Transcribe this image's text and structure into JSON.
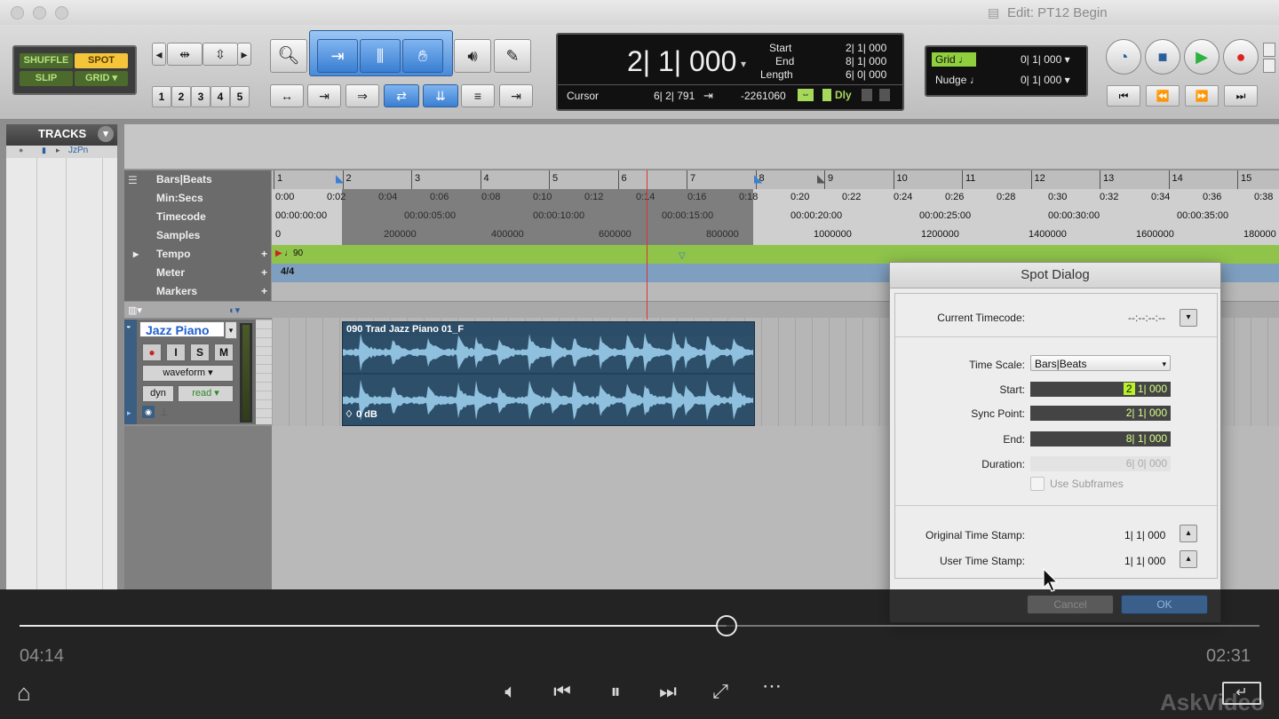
{
  "window": {
    "title": "Edit: PT12 Begin"
  },
  "modes": {
    "shuffle": "SHUFFLE",
    "spot": "SPOT",
    "slip": "SLIP",
    "grid": "GRID"
  },
  "zoom_presets": [
    "1",
    "2",
    "3",
    "4",
    "5"
  ],
  "counter": {
    "main": "2| 1| 000",
    "start_label": "Start",
    "start_value": "2| 1| 000",
    "end_label": "End",
    "end_value": "8| 1| 000",
    "length_label": "Length",
    "length_value": "6| 0| 000",
    "cursor_label": "Cursor",
    "cursor_value": "6| 2| 791",
    "sample_value": "-2261060",
    "dly_label": "Dly"
  },
  "grid_nudge": {
    "grid_label": "Grid",
    "grid_value": "0| 1| 000",
    "nudge_label": "Nudge",
    "nudge_value": "0| 1| 000"
  },
  "tracks_panel": {
    "title": "TRACKS",
    "item": "JzPn"
  },
  "rulers": {
    "bars_beats_label": "Bars|Beats",
    "bars": [
      "1",
      "2",
      "3",
      "4",
      "5",
      "6",
      "7",
      "8",
      "9",
      "10",
      "11",
      "12",
      "13",
      "14",
      "15"
    ],
    "min_secs_label": "Min:Secs",
    "min_secs": [
      "0:00",
      "0:02",
      "0:04",
      "0:06",
      "0:08",
      "0:10",
      "0:12",
      "0:14",
      "0:16",
      "0:18",
      "0:20",
      "0:22",
      "0:24",
      "0:26",
      "0:28",
      "0:30",
      "0:32",
      "0:34",
      "0:36",
      "0:38"
    ],
    "timecode_label": "Timecode",
    "timecodes": [
      "00:00:00:00",
      "00:00:05:00",
      "00:00:10:00",
      "00:00:15:00",
      "00:00:20:00",
      "00:00:25:00",
      "00:00:30:00",
      "00:00:35:00"
    ],
    "samples_label": "Samples",
    "samples": [
      "0",
      "200000",
      "400000",
      "600000",
      "800000",
      "1000000",
      "1200000",
      "1400000",
      "1600000",
      "180000"
    ],
    "tempo_label": "Tempo",
    "tempo_value": "90",
    "meter_label": "Meter",
    "meter_value": "4/4",
    "markers_label": "Markers"
  },
  "track": {
    "name": "Jazz Piano",
    "rec": "●",
    "input": "I",
    "solo": "S",
    "mute": "M",
    "view": "waveform",
    "dyn": "dyn",
    "automation": "read"
  },
  "clip": {
    "name": "090 Trad Jazz Piano 01_F",
    "gain": "0 dB"
  },
  "spot_dialog": {
    "title": "Spot Dialog",
    "current_timecode_label": "Current Timecode:",
    "current_timecode_value": "--:--:--:--",
    "time_scale_label": "Time Scale:",
    "time_scale_value": "Bars|Beats",
    "start_label": "Start:",
    "start_highlight": "2",
    "start_rest": "1| 000",
    "sync_point_label": "Sync Point:",
    "sync_point_value": "2| 1| 000",
    "end_label": "End:",
    "end_value": "8| 1| 000",
    "duration_label": "Duration:",
    "duration_value": "6| 0| 000",
    "use_subframes_label": "Use Subframes",
    "original_ts_label": "Original Time Stamp:",
    "original_ts_value": "1| 1| 000",
    "user_ts_label": "User Time Stamp:",
    "user_ts_value": "1| 1| 000",
    "cancel_label": "Cancel",
    "ok_label": "OK"
  },
  "video": {
    "elapsed": "04:14",
    "remaining": "02:31",
    "progress": 0.57,
    "watermark": "AskVideo"
  }
}
